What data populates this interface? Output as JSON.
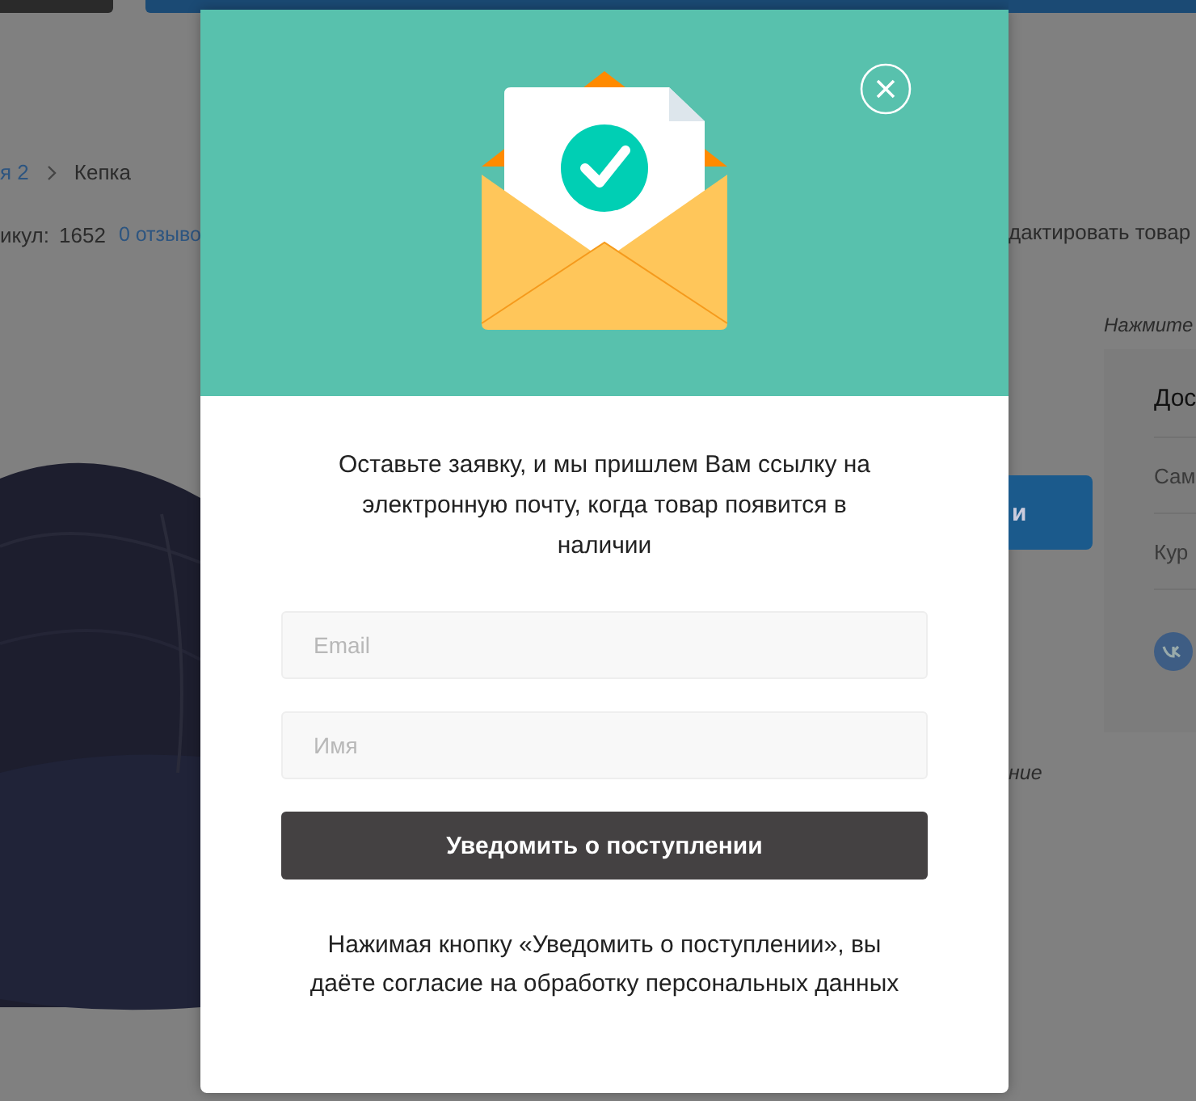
{
  "page": {
    "breadcrumb": {
      "link": "я 2",
      "current": "Кепка"
    },
    "sku_label": "икул:",
    "sku": "1652",
    "reviews": "0 отзыво",
    "edit_link": "дактировать товар",
    "hint": "Нажмите",
    "buy_button": "и",
    "delivery": {
      "title": "Дос",
      "options": [
        "Сам",
        "Кур"
      ]
    },
    "note": "ние"
  },
  "modal": {
    "message": "Оставьте заявку, и мы пришлем Вам ссылку на электронную почту, когда товар появится в наличии",
    "fields": [
      {
        "placeholder": "Email"
      },
      {
        "placeholder": "Имя"
      }
    ],
    "submit": "Уведомить о поступлении",
    "consent": "Нажимая кнопку «Уведомить о поступлении», вы даёте согласие на обработку персональных данных"
  }
}
